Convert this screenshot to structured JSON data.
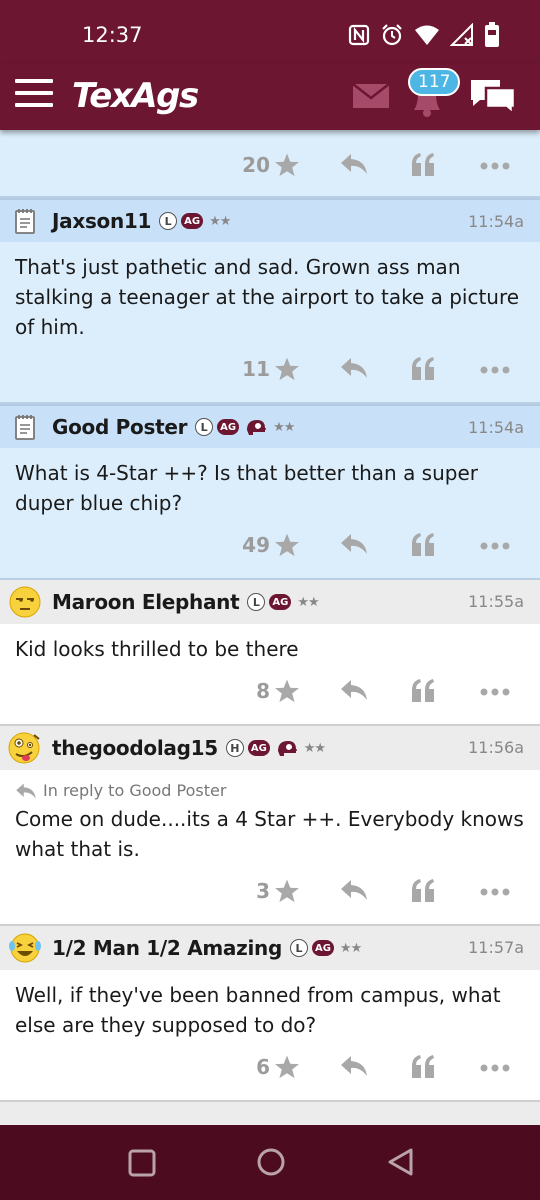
{
  "status_bar": {
    "time": "12:37",
    "icons": [
      "nfc-icon",
      "alarm-icon",
      "wifi-icon",
      "signal-icon",
      "battery-icon"
    ]
  },
  "header": {
    "logo": "TexAgs",
    "notification_count": "117",
    "colors": {
      "maroon": "#6c1632",
      "badge": "#4db6e4"
    }
  },
  "top_partial": {
    "star_count": "20"
  },
  "posts": [
    {
      "username": "Jaxson11",
      "badges": [
        "L",
        "AG"
      ],
      "rank": "★★",
      "time": "11:54a",
      "avatar": "notepad-icon",
      "body": "That's just pathetic and sad. Grown ass man stalking a teenager at the airport to take a picture of him.",
      "star_count": "11",
      "theme": "blue"
    },
    {
      "username": "Good Poster",
      "badges": [
        "L",
        "AG",
        "helmet"
      ],
      "rank": "★★",
      "time": "11:54a",
      "avatar": "notepad-icon",
      "body": "What is 4-Star ++? Is that better than a super duper blue chip?",
      "star_count": "49",
      "theme": "blue"
    },
    {
      "username": "Maroon Elephant",
      "badges": [
        "L",
        "AG"
      ],
      "rank": "★★",
      "time": "11:55a",
      "avatar": "unamused-emoji-icon",
      "body": "Kid looks thrilled to be there",
      "star_count": "8",
      "theme": "white"
    },
    {
      "username": "thegoodolag15",
      "badges": [
        "H",
        "AG",
        "helmet"
      ],
      "rank": "★★",
      "time": "11:56a",
      "avatar": "zany-emoji-icon",
      "reply_to": "In reply to Good Poster",
      "body": "Come on dude....its a 4 Star ++. Everybody knows what that is.",
      "star_count": "3",
      "theme": "white"
    },
    {
      "username": "1/2 Man 1/2 Amazing",
      "badges": [
        "L",
        "AG"
      ],
      "rank": "★★",
      "time": "11:57a",
      "avatar": "laughing-emoji-icon",
      "body": "Well, if they've been banned from campus, what else are they supposed to do?",
      "star_count": "6",
      "theme": "white"
    }
  ],
  "badges_text": {
    "L": "L",
    "H": "H",
    "AG": "AG"
  }
}
